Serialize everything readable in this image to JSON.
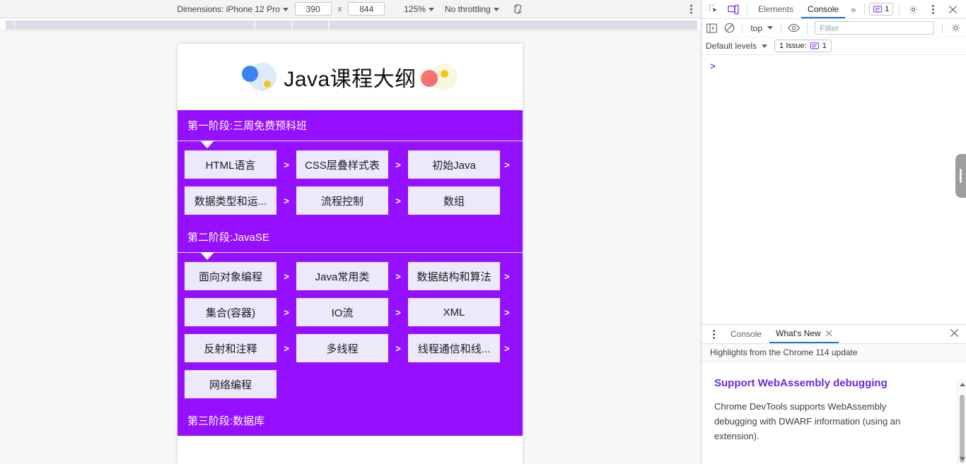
{
  "device_toolbar": {
    "dimensions_label": "Dimensions: iPhone 12 Pro",
    "width_value": "390",
    "x_label": "x",
    "height_value": "844",
    "zoom_label": "125%",
    "throttle_label": "No throttling",
    "rotate_icon": "rotate-icon",
    "more_options_icon": "kebab-menu-icon"
  },
  "page": {
    "title": "Java课程大纲",
    "stages": [
      {
        "title": "第一阶段:三周免费预科班",
        "rows": [
          {
            "courses": [
              "HTML语言",
              "CSS层叠样式表",
              "初始Java"
            ],
            "trailing_chevron": ">"
          },
          {
            "courses": [
              "数据类型和运...",
              "流程控制",
              "数组"
            ],
            "trailing_chevron": ""
          }
        ]
      },
      {
        "title": "第二阶段:JavaSE",
        "rows": [
          {
            "courses": [
              "面向对象编程",
              "Java常用类",
              "数据结构和算法"
            ],
            "trailing_chevron": ">"
          },
          {
            "courses": [
              "集合(容器)",
              "IO流",
              "XML"
            ],
            "trailing_chevron": ">"
          },
          {
            "courses": [
              "反射和注释",
              "多线程",
              "线程通信和线..."
            ],
            "trailing_chevron": ">"
          },
          {
            "courses": [
              "网络编程"
            ],
            "trailing_chevron": ""
          }
        ]
      },
      {
        "title": "第三阶段:数据库",
        "rows": []
      }
    ],
    "chevron": ">",
    "accent_purple": "#9510ff",
    "course_box_bg": "#ece9fb"
  },
  "devtools": {
    "tabbar": {
      "inspect_icon": "inspect-element-icon",
      "device_toggle_icon": "device-toolbar-icon",
      "tabs": [
        {
          "label": "Elements",
          "active": false
        },
        {
          "label": "Console",
          "active": true
        }
      ],
      "more_tabs_label": "»",
      "issues_count": "1",
      "settings_icon": "gear-icon",
      "more_icon": "kebab-menu-icon",
      "close_icon": "close-icon"
    },
    "console_toolbar": {
      "sidebar_icon": "console-sidebar-icon",
      "clear_icon": "clear-console-icon",
      "context_label": "top",
      "eye_icon": "live-expression-icon",
      "filter_placeholder": "Filter",
      "filter_value": "",
      "settings_icon": "gear-icon"
    },
    "console_levels": {
      "levels_label": "Default levels",
      "issues_label": "1 Issue:",
      "issues_count": "1"
    },
    "console_prompt": ">",
    "drawer": {
      "more_icon": "kebab-menu-icon",
      "tabs": [
        {
          "label": "Console",
          "active": false
        },
        {
          "label": "What's New",
          "active": true
        }
      ],
      "tab_close_icon": "close-icon",
      "drawer_close_icon": "close-icon",
      "subtitle": "Highlights from the Chrome 114 update",
      "article_heading": "Support WebAssembly debugging",
      "article_body": "Chrome DevTools supports WebAssembly debugging with DWARF information (using an extension).",
      "heading_color": "#6c2bd9"
    }
  }
}
